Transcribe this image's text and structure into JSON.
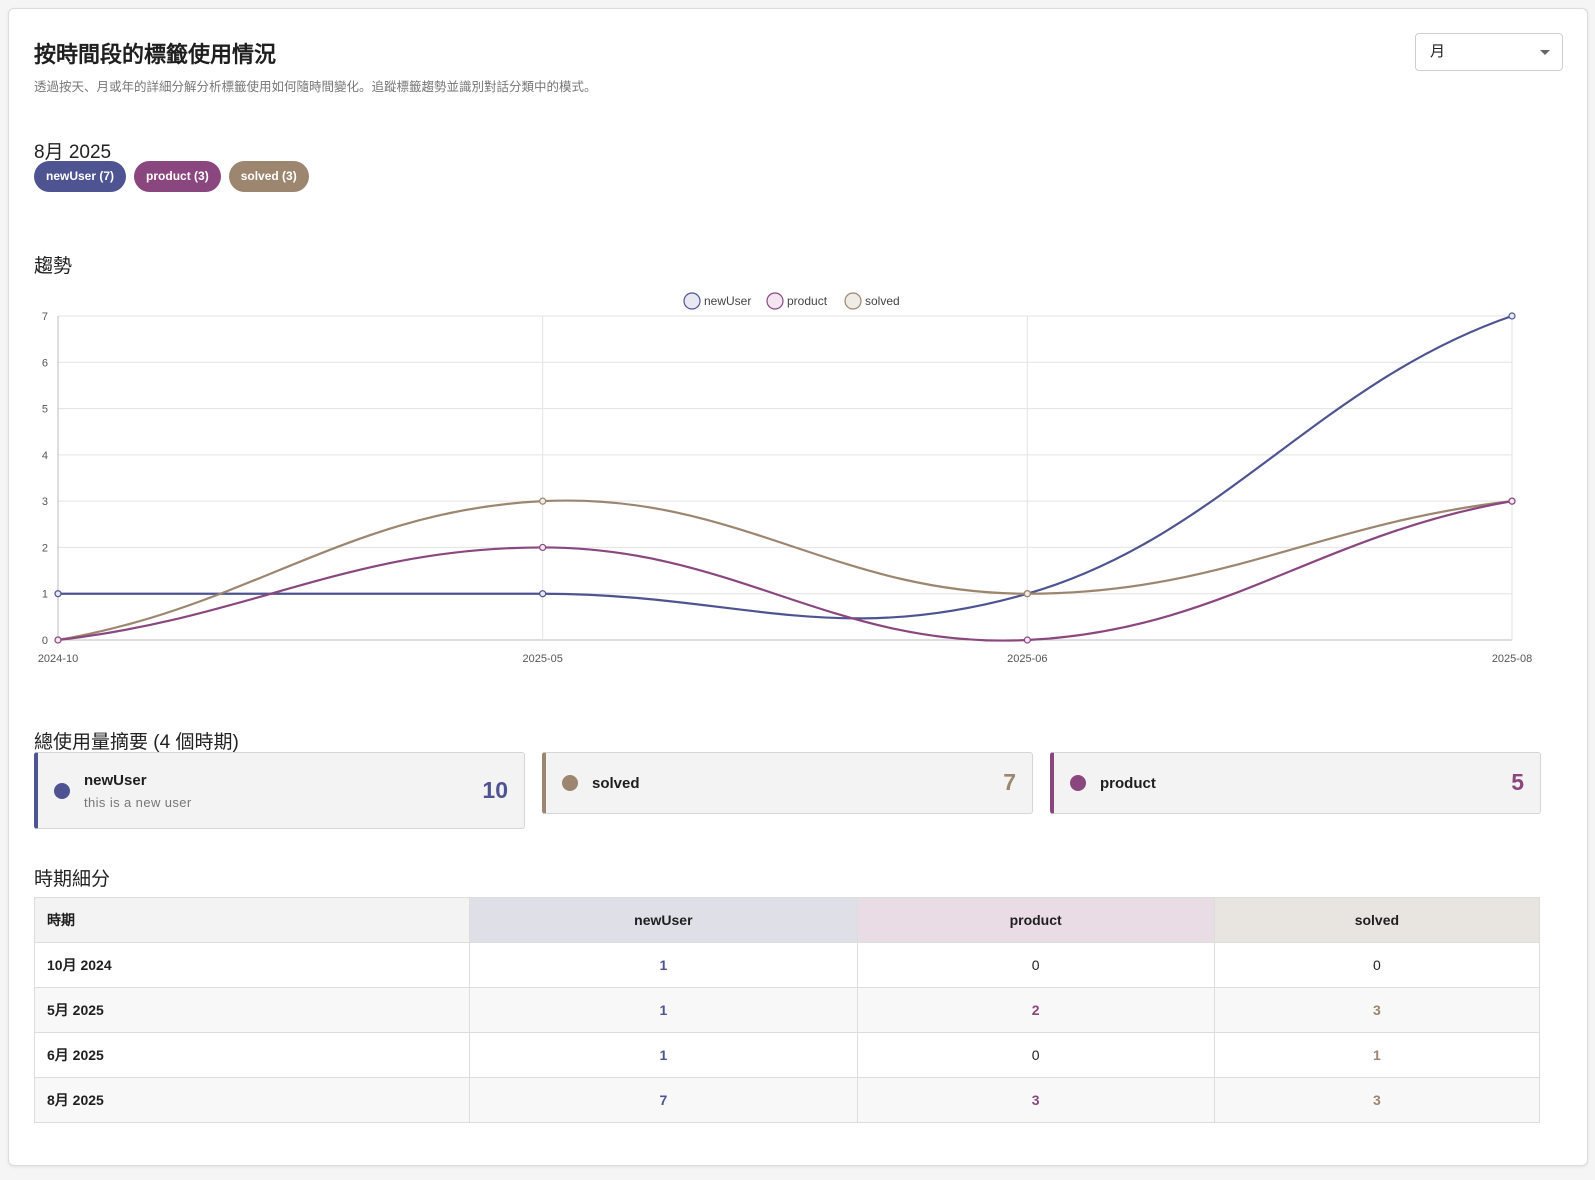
{
  "header": {
    "title": "按時間段的標籤使用情況",
    "description": "透過按天、月或年的詳細分解分析標籤使用如何隨時間變化。追蹤標籤趨勢並識別對話分類中的模式。"
  },
  "period_select": {
    "value": "月"
  },
  "current_period": {
    "label": "8月 2025",
    "chips": [
      {
        "text": "newUser (7)",
        "color": "#4e5491"
      },
      {
        "text": "product (3)",
        "color": "#8a477f"
      },
      {
        "text": "solved (3)",
        "color": "#9c866f"
      }
    ]
  },
  "trend": {
    "heading": "趨勢"
  },
  "colors": {
    "newUser": "#4e5491",
    "product": "#8a477f",
    "solved": "#9c866f"
  },
  "chart_data": {
    "type": "line",
    "x": [
      "2024-10",
      "2025-05",
      "2025-06",
      "2025-08"
    ],
    "series": [
      {
        "name": "newUser",
        "values": [
          1,
          1,
          1,
          7
        ],
        "color": "#4e5491",
        "fill": "#e8e8f3"
      },
      {
        "name": "product",
        "values": [
          0,
          2,
          0,
          3
        ],
        "color": "#8a477f",
        "fill": "#f3e6f0"
      },
      {
        "name": "solved",
        "values": [
          0,
          3,
          1,
          3
        ],
        "color": "#9c866f",
        "fill": "#efebe6"
      }
    ],
    "ylim": [
      0,
      7
    ],
    "yticks": [
      0,
      1,
      2,
      3,
      4,
      5,
      6,
      7
    ],
    "legend": "top-center",
    "grid": true
  },
  "summary": {
    "heading": "總使用量摘要 (4 個時期)",
    "cards": [
      {
        "name": "newUser",
        "description": "this is a new user",
        "count": "10",
        "color": "#4e5491"
      },
      {
        "name": "solved",
        "description": "",
        "count": "7",
        "color": "#9c866f"
      },
      {
        "name": "product",
        "description": "",
        "count": "5",
        "color": "#8a477f"
      }
    ]
  },
  "breakdown": {
    "heading": "時期細分",
    "columns": [
      {
        "label": "時期",
        "bg": "#f3f3f3",
        "align": "left"
      },
      {
        "label": "newUser",
        "bg": "#dfdfe7",
        "align": "center"
      },
      {
        "label": "product",
        "bg": "#e9dce5",
        "align": "center"
      },
      {
        "label": "solved",
        "bg": "#e8e5e1",
        "align": "center"
      }
    ],
    "rows": [
      {
        "period": "10月 2024",
        "values": [
          "1",
          "0",
          "0"
        ]
      },
      {
        "period": "5月 2025",
        "values": [
          "1",
          "2",
          "3"
        ]
      },
      {
        "period": "6月 2025",
        "values": [
          "1",
          "0",
          "1"
        ]
      },
      {
        "period": "8月 2025",
        "values": [
          "7",
          "3",
          "3"
        ]
      }
    ]
  }
}
